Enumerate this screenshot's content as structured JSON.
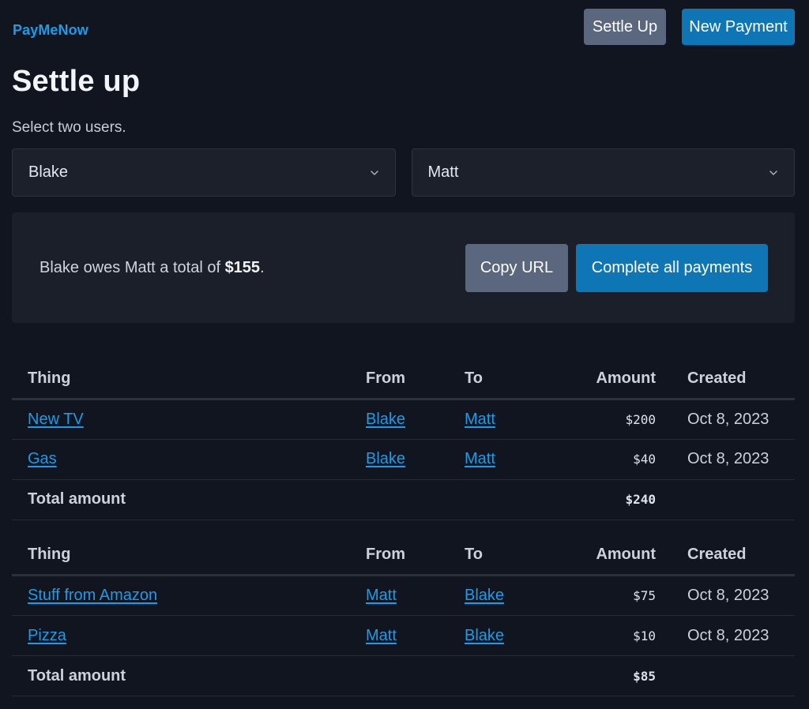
{
  "header": {
    "brand": "PayMeNow",
    "settle_up_label": "Settle Up",
    "new_payment_label": "New Payment"
  },
  "page": {
    "title": "Settle up",
    "subtitle": "Select two users."
  },
  "selects": {
    "user_a": "Blake",
    "user_b": "Matt"
  },
  "summary": {
    "prefix": "Blake owes Matt a total of ",
    "amount": "$155",
    "suffix": ".",
    "copy_url_label": "Copy URL",
    "complete_label": "Complete all payments"
  },
  "columns": {
    "thing": "Thing",
    "from": "From",
    "to": "To",
    "amount": "Amount",
    "created": "Created"
  },
  "tables": [
    {
      "rows": [
        {
          "thing": "New TV",
          "from": "Blake",
          "to": "Matt",
          "amount": "$200",
          "created": "Oct 8, 2023"
        },
        {
          "thing": "Gas",
          "from": "Blake",
          "to": "Matt",
          "amount": "$40",
          "created": "Oct 8, 2023"
        }
      ],
      "total_label": "Total amount",
      "total_amount": "$240"
    },
    {
      "rows": [
        {
          "thing": "Stuff from Amazon",
          "from": "Matt",
          "to": "Blake",
          "amount": "$75",
          "created": "Oct 8, 2023"
        },
        {
          "thing": "Pizza",
          "from": "Matt",
          "to": "Blake",
          "amount": "$10",
          "created": "Oct 8, 2023"
        }
      ],
      "total_label": "Total amount",
      "total_amount": "$85"
    }
  ],
  "colors": {
    "background": "#11151f",
    "link": "#1e9be8",
    "primary_button": "#0f76b6",
    "secondary_button": "#5b667f"
  }
}
